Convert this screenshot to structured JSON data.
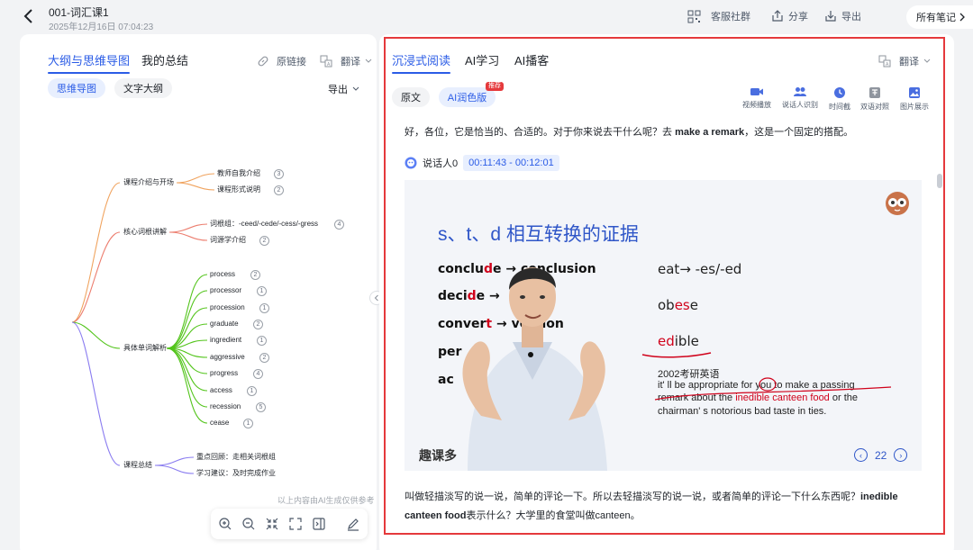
{
  "header": {
    "title": "001-词汇课1",
    "date": "2025年12月16日 07:04:23",
    "buttons": {
      "community": "客服社群",
      "share": "分享",
      "export": "导出",
      "all_notes": "所有笔记"
    }
  },
  "left": {
    "tabs": [
      "大纲与思维导图",
      "我的总结"
    ],
    "original_link": "原链接",
    "translate": "翻译",
    "view_pills": [
      "思维导图",
      "文字大纲"
    ],
    "export": "导出",
    "disclaimer": "以上内容由AI生成仅供参考",
    "mindmap": {
      "branches": [
        {
          "label": "课程介绍与开场",
          "children": [
            {
              "label": "教师自我介绍",
              "count": "3"
            },
            {
              "label": "课程形式说明",
              "count": "2"
            }
          ]
        },
        {
          "label": "核心词根讲解",
          "children": [
            {
              "label": "词根组：-ceed/-cede/-cess/-gress",
              "count": "4"
            },
            {
              "label": "词源学介绍",
              "count": "2"
            }
          ]
        },
        {
          "label": "具体单词解析",
          "children": [
            {
              "label": "process",
              "count": "2"
            },
            {
              "label": "processor",
              "count": "1"
            },
            {
              "label": "procession",
              "count": "1"
            },
            {
              "label": "graduate",
              "count": "2"
            },
            {
              "label": "ingredient",
              "count": "1"
            },
            {
              "label": "aggressive",
              "count": "2"
            },
            {
              "label": "progress",
              "count": "4"
            },
            {
              "label": "access",
              "count": "1"
            },
            {
              "label": "recession",
              "count": "5"
            },
            {
              "label": "cease",
              "count": "1"
            }
          ]
        },
        {
          "label": "课程总结",
          "children": [
            {
              "label": "重点回顾：走相关词根组",
              "count": ""
            },
            {
              "label": "学习建议：及时完成作业",
              "count": ""
            }
          ]
        }
      ],
      "colors": {
        "b1": "#f0a35e",
        "b2": "#ec7d6e",
        "b3": "#52c41a",
        "b4": "#8a7cf0"
      }
    }
  },
  "right": {
    "tabs": [
      "沉浸式阅读",
      "AI学习",
      "AI播客"
    ],
    "translate": "翻译",
    "version_pills": [
      "原文",
      "AI润色版"
    ],
    "recommend_tag": "推荐",
    "tools": [
      "视频播放",
      "说话人识别",
      "时间截",
      "双语对照",
      "图片展示"
    ],
    "para1": {
      "a": "好，各位，它是恰当的、合适的。对于你来说去干什么呢？去 ",
      "b": "make a remark",
      "c": "，这是一个固定的搭配。"
    },
    "speaker": "说话人0",
    "timestamp": "00:11:43 - 00:12:01",
    "para2": {
      "a": "叫做轻描淡写的说一说，简单的评论一下。所以去轻描淡写的说一说，或者简单的评论一下什么东西呢？",
      "b": "inedible canteen food",
      "c": "表示什么？大学里的食堂叫做canteen。"
    },
    "video": {
      "heading": "s、t、d 相互转换的证据",
      "left_words": [
        {
          "pre": "conclu",
          "red": "d",
          "post": "e → conclusion"
        },
        {
          "pre": "deci",
          "red": "d",
          "post": "e →"
        },
        {
          "pre": "conver",
          "red": "t",
          "post": " →   version"
        },
        {
          "pre": "per",
          "red": "",
          "post": ""
        },
        {
          "pre": "ac",
          "red": "",
          "post": ""
        }
      ],
      "right_words": [
        {
          "pre": "eat",
          "red": "",
          "post": "→ -es/-ed"
        },
        {
          "pre": "ob",
          "red": "es",
          "post": "e"
        },
        {
          "pre": "",
          "red": "ed",
          "post": "ible"
        }
      ],
      "exam_title": "2002考研英语",
      "sentence_1": "it' ll be appropriate for you to make a passing",
      "sentence_2a": "remark about the ",
      "sentence_2b": "inedible canteen food",
      "sentence_2c": " or the",
      "sentence_3": "chairman' s notorious bad taste in ties.",
      "page": "22",
      "logo": "趣课多"
    }
  }
}
